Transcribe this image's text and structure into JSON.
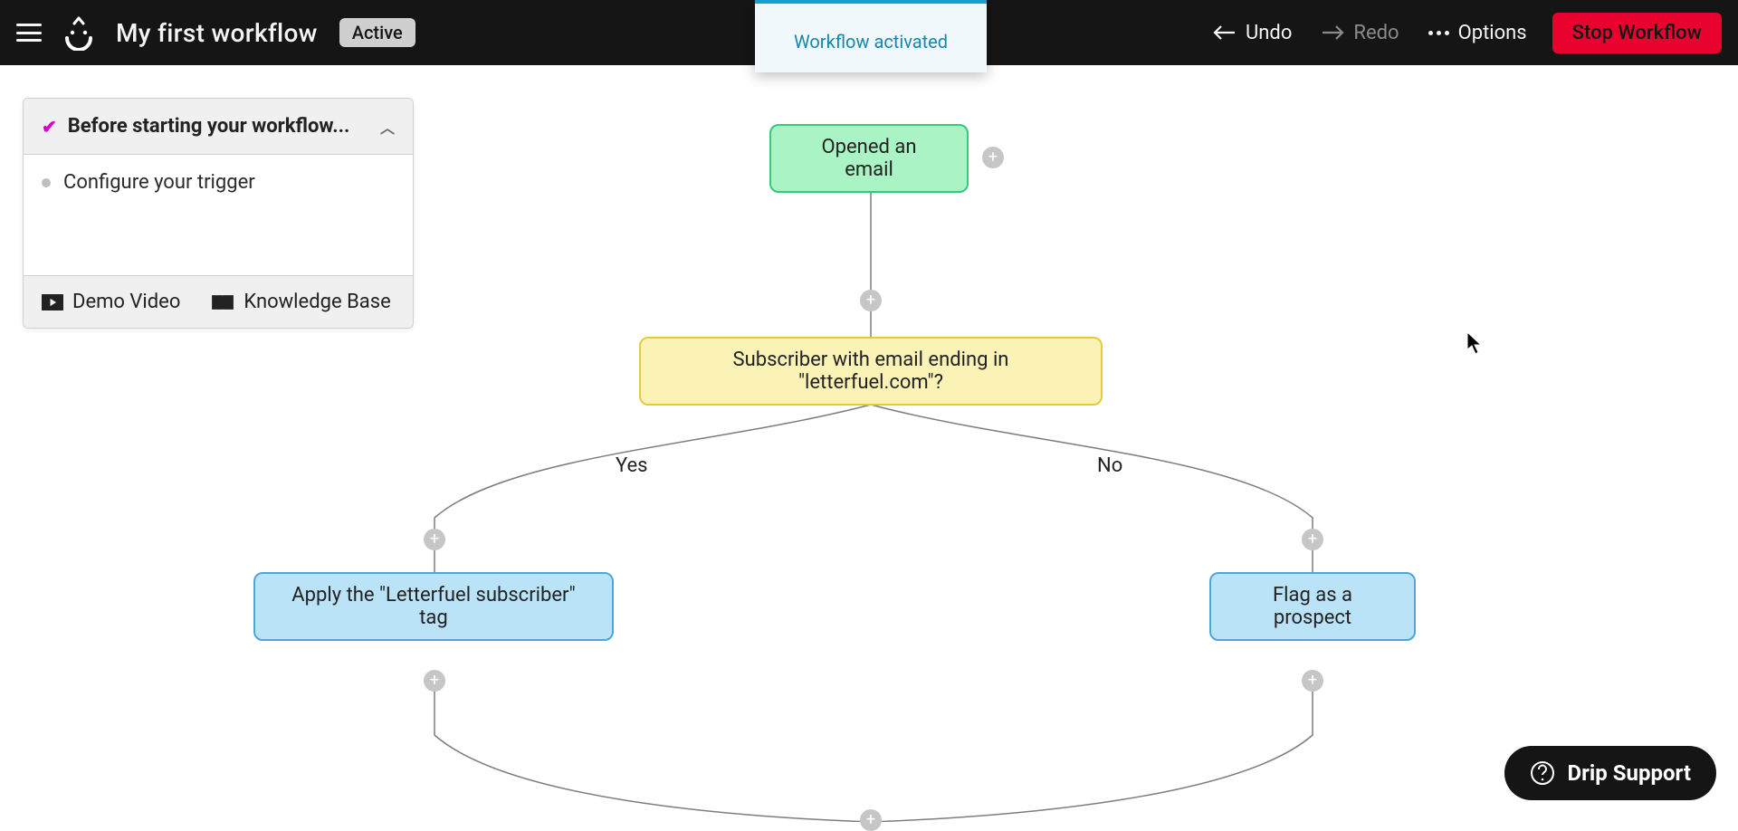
{
  "topbar": {
    "title": "My first workflow",
    "status_label": "Active",
    "undo_label": "Undo",
    "redo_label": "Redo",
    "options_label": "Options",
    "stop_label": "Stop Workflow"
  },
  "toast": {
    "text": "Workflow activated"
  },
  "checklist": {
    "heading": "Before starting your workflow...",
    "items": [
      {
        "label": "Configure your trigger",
        "done": false
      }
    ],
    "demo_label": "Demo Video",
    "kb_label": "Knowledge Base"
  },
  "workflow": {
    "trigger": {
      "label": "Opened an email"
    },
    "decision": {
      "label": "Subscriber with email ending in \"letterfuel.com\"?"
    },
    "branch_yes_label": "Yes",
    "branch_no_label": "No",
    "action_yes": {
      "label": "Apply the \"Letterfuel subscriber\" tag"
    },
    "action_no": {
      "label": "Flag as a prospect"
    }
  },
  "support": {
    "label": "Drip Support"
  }
}
